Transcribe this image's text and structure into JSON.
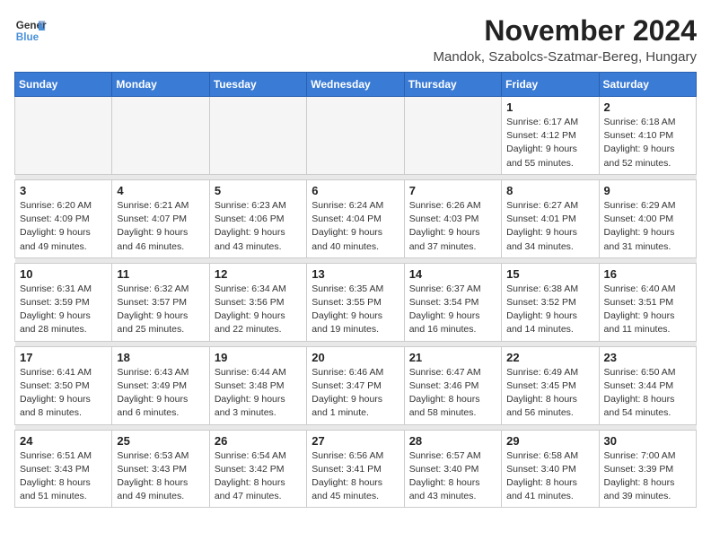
{
  "logo": {
    "line1": "General",
    "line2": "Blue"
  },
  "title": "November 2024",
  "location": "Mandok, Szabolcs-Szatmar-Bereg, Hungary",
  "days_of_week": [
    "Sunday",
    "Monday",
    "Tuesday",
    "Wednesday",
    "Thursday",
    "Friday",
    "Saturday"
  ],
  "weeks": [
    {
      "days": [
        {
          "num": "",
          "info": ""
        },
        {
          "num": "",
          "info": ""
        },
        {
          "num": "",
          "info": ""
        },
        {
          "num": "",
          "info": ""
        },
        {
          "num": "",
          "info": ""
        },
        {
          "num": "1",
          "info": "Sunrise: 6:17 AM\nSunset: 4:12 PM\nDaylight: 9 hours and 55 minutes."
        },
        {
          "num": "2",
          "info": "Sunrise: 6:18 AM\nSunset: 4:10 PM\nDaylight: 9 hours and 52 minutes."
        }
      ]
    },
    {
      "days": [
        {
          "num": "3",
          "info": "Sunrise: 6:20 AM\nSunset: 4:09 PM\nDaylight: 9 hours and 49 minutes."
        },
        {
          "num": "4",
          "info": "Sunrise: 6:21 AM\nSunset: 4:07 PM\nDaylight: 9 hours and 46 minutes."
        },
        {
          "num": "5",
          "info": "Sunrise: 6:23 AM\nSunset: 4:06 PM\nDaylight: 9 hours and 43 minutes."
        },
        {
          "num": "6",
          "info": "Sunrise: 6:24 AM\nSunset: 4:04 PM\nDaylight: 9 hours and 40 minutes."
        },
        {
          "num": "7",
          "info": "Sunrise: 6:26 AM\nSunset: 4:03 PM\nDaylight: 9 hours and 37 minutes."
        },
        {
          "num": "8",
          "info": "Sunrise: 6:27 AM\nSunset: 4:01 PM\nDaylight: 9 hours and 34 minutes."
        },
        {
          "num": "9",
          "info": "Sunrise: 6:29 AM\nSunset: 4:00 PM\nDaylight: 9 hours and 31 minutes."
        }
      ]
    },
    {
      "days": [
        {
          "num": "10",
          "info": "Sunrise: 6:31 AM\nSunset: 3:59 PM\nDaylight: 9 hours and 28 minutes."
        },
        {
          "num": "11",
          "info": "Sunrise: 6:32 AM\nSunset: 3:57 PM\nDaylight: 9 hours and 25 minutes."
        },
        {
          "num": "12",
          "info": "Sunrise: 6:34 AM\nSunset: 3:56 PM\nDaylight: 9 hours and 22 minutes."
        },
        {
          "num": "13",
          "info": "Sunrise: 6:35 AM\nSunset: 3:55 PM\nDaylight: 9 hours and 19 minutes."
        },
        {
          "num": "14",
          "info": "Sunrise: 6:37 AM\nSunset: 3:54 PM\nDaylight: 9 hours and 16 minutes."
        },
        {
          "num": "15",
          "info": "Sunrise: 6:38 AM\nSunset: 3:52 PM\nDaylight: 9 hours and 14 minutes."
        },
        {
          "num": "16",
          "info": "Sunrise: 6:40 AM\nSunset: 3:51 PM\nDaylight: 9 hours and 11 minutes."
        }
      ]
    },
    {
      "days": [
        {
          "num": "17",
          "info": "Sunrise: 6:41 AM\nSunset: 3:50 PM\nDaylight: 9 hours and 8 minutes."
        },
        {
          "num": "18",
          "info": "Sunrise: 6:43 AM\nSunset: 3:49 PM\nDaylight: 9 hours and 6 minutes."
        },
        {
          "num": "19",
          "info": "Sunrise: 6:44 AM\nSunset: 3:48 PM\nDaylight: 9 hours and 3 minutes."
        },
        {
          "num": "20",
          "info": "Sunrise: 6:46 AM\nSunset: 3:47 PM\nDaylight: 9 hours and 1 minute."
        },
        {
          "num": "21",
          "info": "Sunrise: 6:47 AM\nSunset: 3:46 PM\nDaylight: 8 hours and 58 minutes."
        },
        {
          "num": "22",
          "info": "Sunrise: 6:49 AM\nSunset: 3:45 PM\nDaylight: 8 hours and 56 minutes."
        },
        {
          "num": "23",
          "info": "Sunrise: 6:50 AM\nSunset: 3:44 PM\nDaylight: 8 hours and 54 minutes."
        }
      ]
    },
    {
      "days": [
        {
          "num": "24",
          "info": "Sunrise: 6:51 AM\nSunset: 3:43 PM\nDaylight: 8 hours and 51 minutes."
        },
        {
          "num": "25",
          "info": "Sunrise: 6:53 AM\nSunset: 3:43 PM\nDaylight: 8 hours and 49 minutes."
        },
        {
          "num": "26",
          "info": "Sunrise: 6:54 AM\nSunset: 3:42 PM\nDaylight: 8 hours and 47 minutes."
        },
        {
          "num": "27",
          "info": "Sunrise: 6:56 AM\nSunset: 3:41 PM\nDaylight: 8 hours and 45 minutes."
        },
        {
          "num": "28",
          "info": "Sunrise: 6:57 AM\nSunset: 3:40 PM\nDaylight: 8 hours and 43 minutes."
        },
        {
          "num": "29",
          "info": "Sunrise: 6:58 AM\nSunset: 3:40 PM\nDaylight: 8 hours and 41 minutes."
        },
        {
          "num": "30",
          "info": "Sunrise: 7:00 AM\nSunset: 3:39 PM\nDaylight: 8 hours and 39 minutes."
        }
      ]
    }
  ]
}
